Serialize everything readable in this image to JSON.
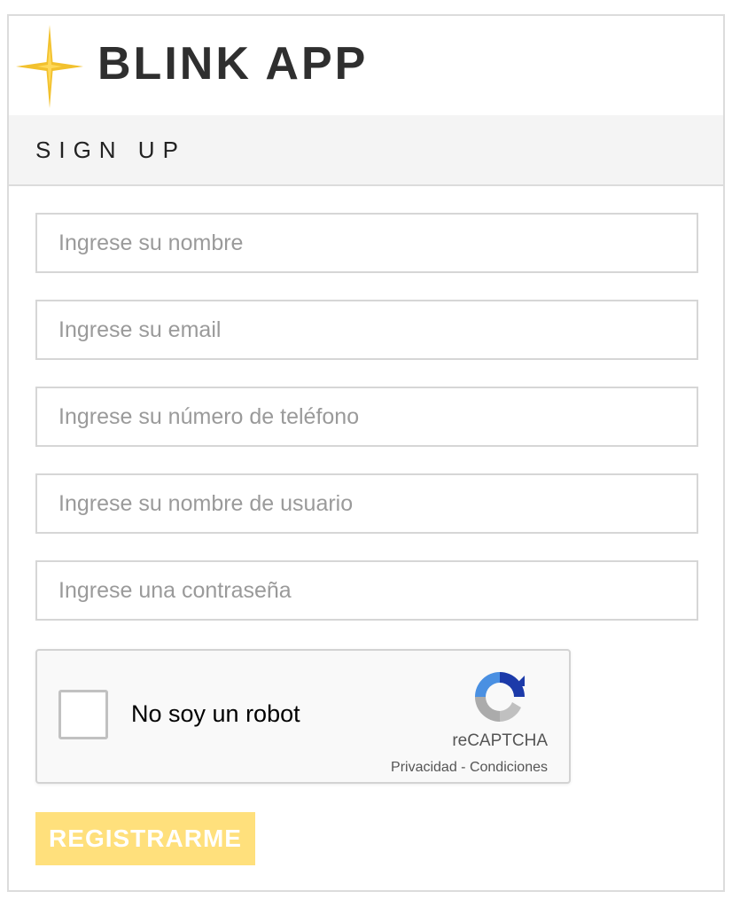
{
  "app": {
    "title": "BLINK APP",
    "accent_color": "#f2c12e",
    "logo_icon": "star-sparkle-icon"
  },
  "form": {
    "section_title": "SIGN UP",
    "fields": [
      {
        "name": "nombre",
        "placeholder": "Ingrese su nombre",
        "value": ""
      },
      {
        "name": "email",
        "placeholder": "Ingrese su email",
        "value": ""
      },
      {
        "name": "telefono",
        "placeholder": "Ingrese su número de teléfono",
        "value": ""
      },
      {
        "name": "usuario",
        "placeholder": "Ingrese su nombre de usuario",
        "value": ""
      },
      {
        "name": "contrasena",
        "placeholder": "Ingrese una contraseña",
        "value": ""
      }
    ],
    "captcha": {
      "label": "No soy un robot",
      "brand": "reCAPTCHA",
      "privacy": "Privacidad",
      "separator": " - ",
      "terms": "Condiciones",
      "checked": false,
      "icon": "recaptcha-logo-icon"
    },
    "submit_label": "REGISTRARME",
    "submit_color": "#ffe07c"
  }
}
